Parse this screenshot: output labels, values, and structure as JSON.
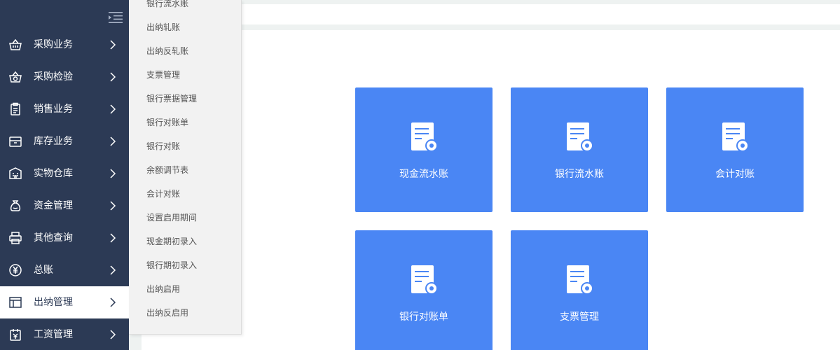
{
  "sidebar": {
    "items": [
      {
        "label": "采购业务",
        "icon": "basket-icon"
      },
      {
        "label": "采购检验",
        "icon": "inspection-icon"
      },
      {
        "label": "销售业务",
        "icon": "clipboard-icon"
      },
      {
        "label": "库存业务",
        "icon": "inventory-icon"
      },
      {
        "label": "实物仓库",
        "icon": "warehouse-icon"
      },
      {
        "label": "资金管理",
        "icon": "money-bag-icon"
      },
      {
        "label": "其他查询",
        "icon": "printer-icon"
      },
      {
        "label": "总账",
        "icon": "yen-icon"
      },
      {
        "label": "出纳管理",
        "icon": "layout-icon",
        "active": true
      },
      {
        "label": "工资管理",
        "icon": "payroll-icon"
      }
    ]
  },
  "submenu": {
    "items": [
      "银行流水账",
      "出纳轧账",
      "出纳反轧账",
      "支票管理",
      "银行票据管理",
      "银行对账单",
      "银行对账",
      "余额调节表",
      "会计对账",
      "设置启用期间",
      "现金期初录入",
      "银行期初录入",
      "出纳启用",
      "出纳反启用"
    ]
  },
  "tiles": [
    {
      "label": "现金流水账"
    },
    {
      "label": "银行流水账"
    },
    {
      "label": "会计对账"
    },
    {
      "label": "银行对账单"
    },
    {
      "label": "支票管理"
    }
  ],
  "colors": {
    "sidebar_bg": "#2c3a55",
    "tile_bg": "#4a86f4",
    "submenu_bg": "#f2f2f2"
  }
}
